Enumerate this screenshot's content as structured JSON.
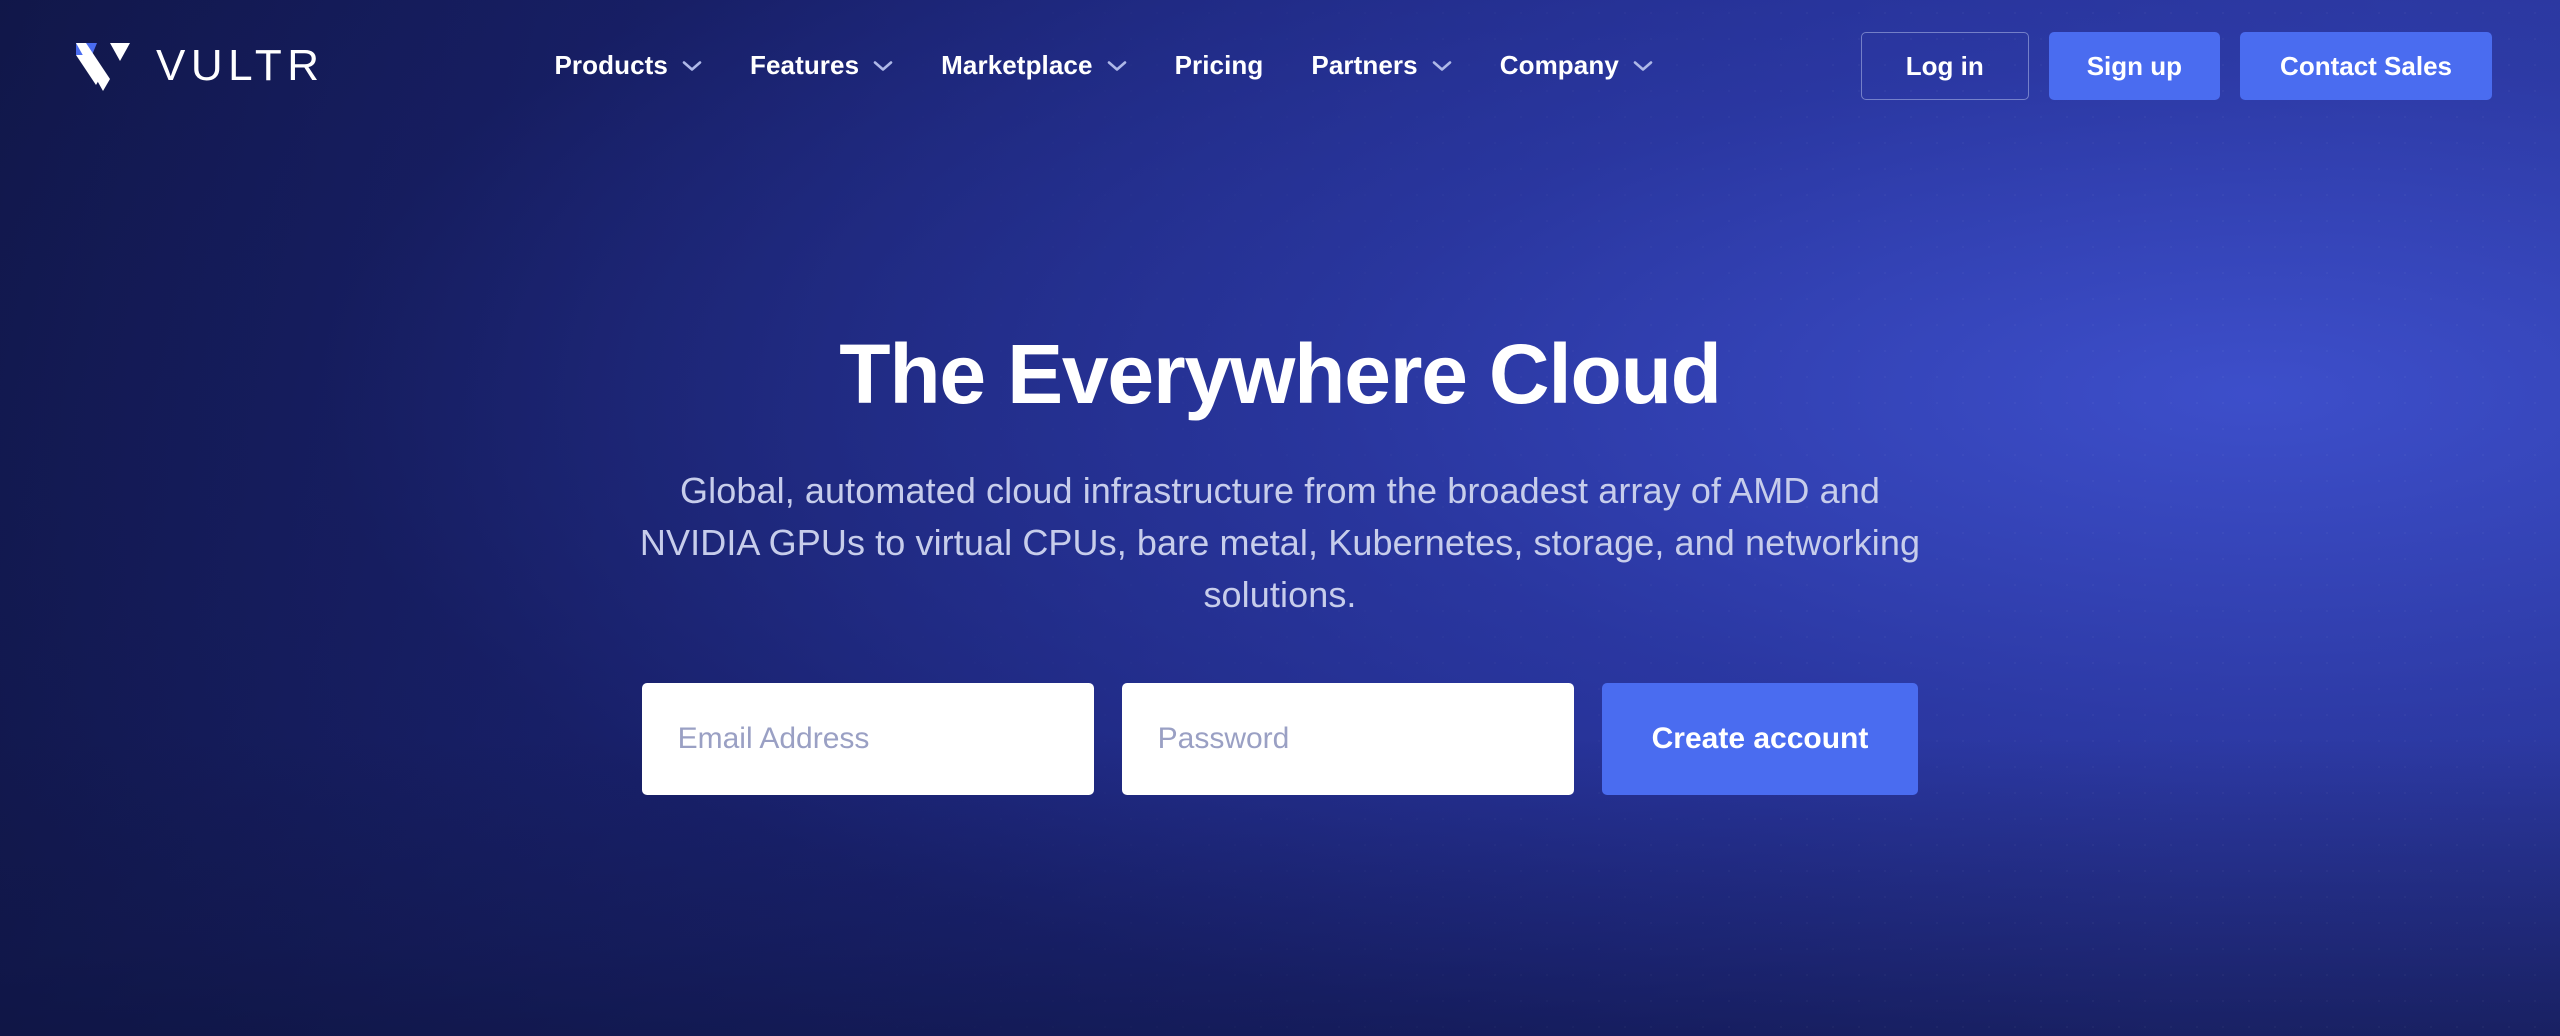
{
  "brand": {
    "name": "VULTR",
    "logo_icon": "vultr-v-logo-icon",
    "logo_accent_color": "#4a6cf0"
  },
  "header": {
    "nav": [
      {
        "label": "Products",
        "has_dropdown": true,
        "icon": "chevron-down-icon"
      },
      {
        "label": "Features",
        "has_dropdown": true,
        "icon": "chevron-down-icon"
      },
      {
        "label": "Marketplace",
        "has_dropdown": true,
        "icon": "chevron-down-icon"
      },
      {
        "label": "Pricing",
        "has_dropdown": false,
        "icon": ""
      },
      {
        "label": "Partners",
        "has_dropdown": true,
        "icon": "chevron-down-icon"
      },
      {
        "label": "Company",
        "has_dropdown": true,
        "icon": "chevron-down-icon"
      }
    ],
    "actions": {
      "login": "Log in",
      "signup": "Sign up",
      "contact_sales": "Contact Sales"
    }
  },
  "hero": {
    "title": "The Everywhere Cloud",
    "subtitle": "Global, automated cloud infrastructure from the broadest array of AMD and NVIDIA GPUs to virtual CPUs, bare metal, Kubernetes, storage, and networking solutions.",
    "form": {
      "email_placeholder": "Email Address",
      "email_value": "",
      "password_placeholder": "Password",
      "password_value": "",
      "submit_label": "Create account"
    }
  },
  "colors": {
    "accent_blue": "#4a6cf0",
    "background_dark": "#101646",
    "background_light": "#2b369c",
    "text_primary": "#ffffff",
    "text_muted": "#c7cdeb",
    "placeholder": "#9aa0c4"
  }
}
